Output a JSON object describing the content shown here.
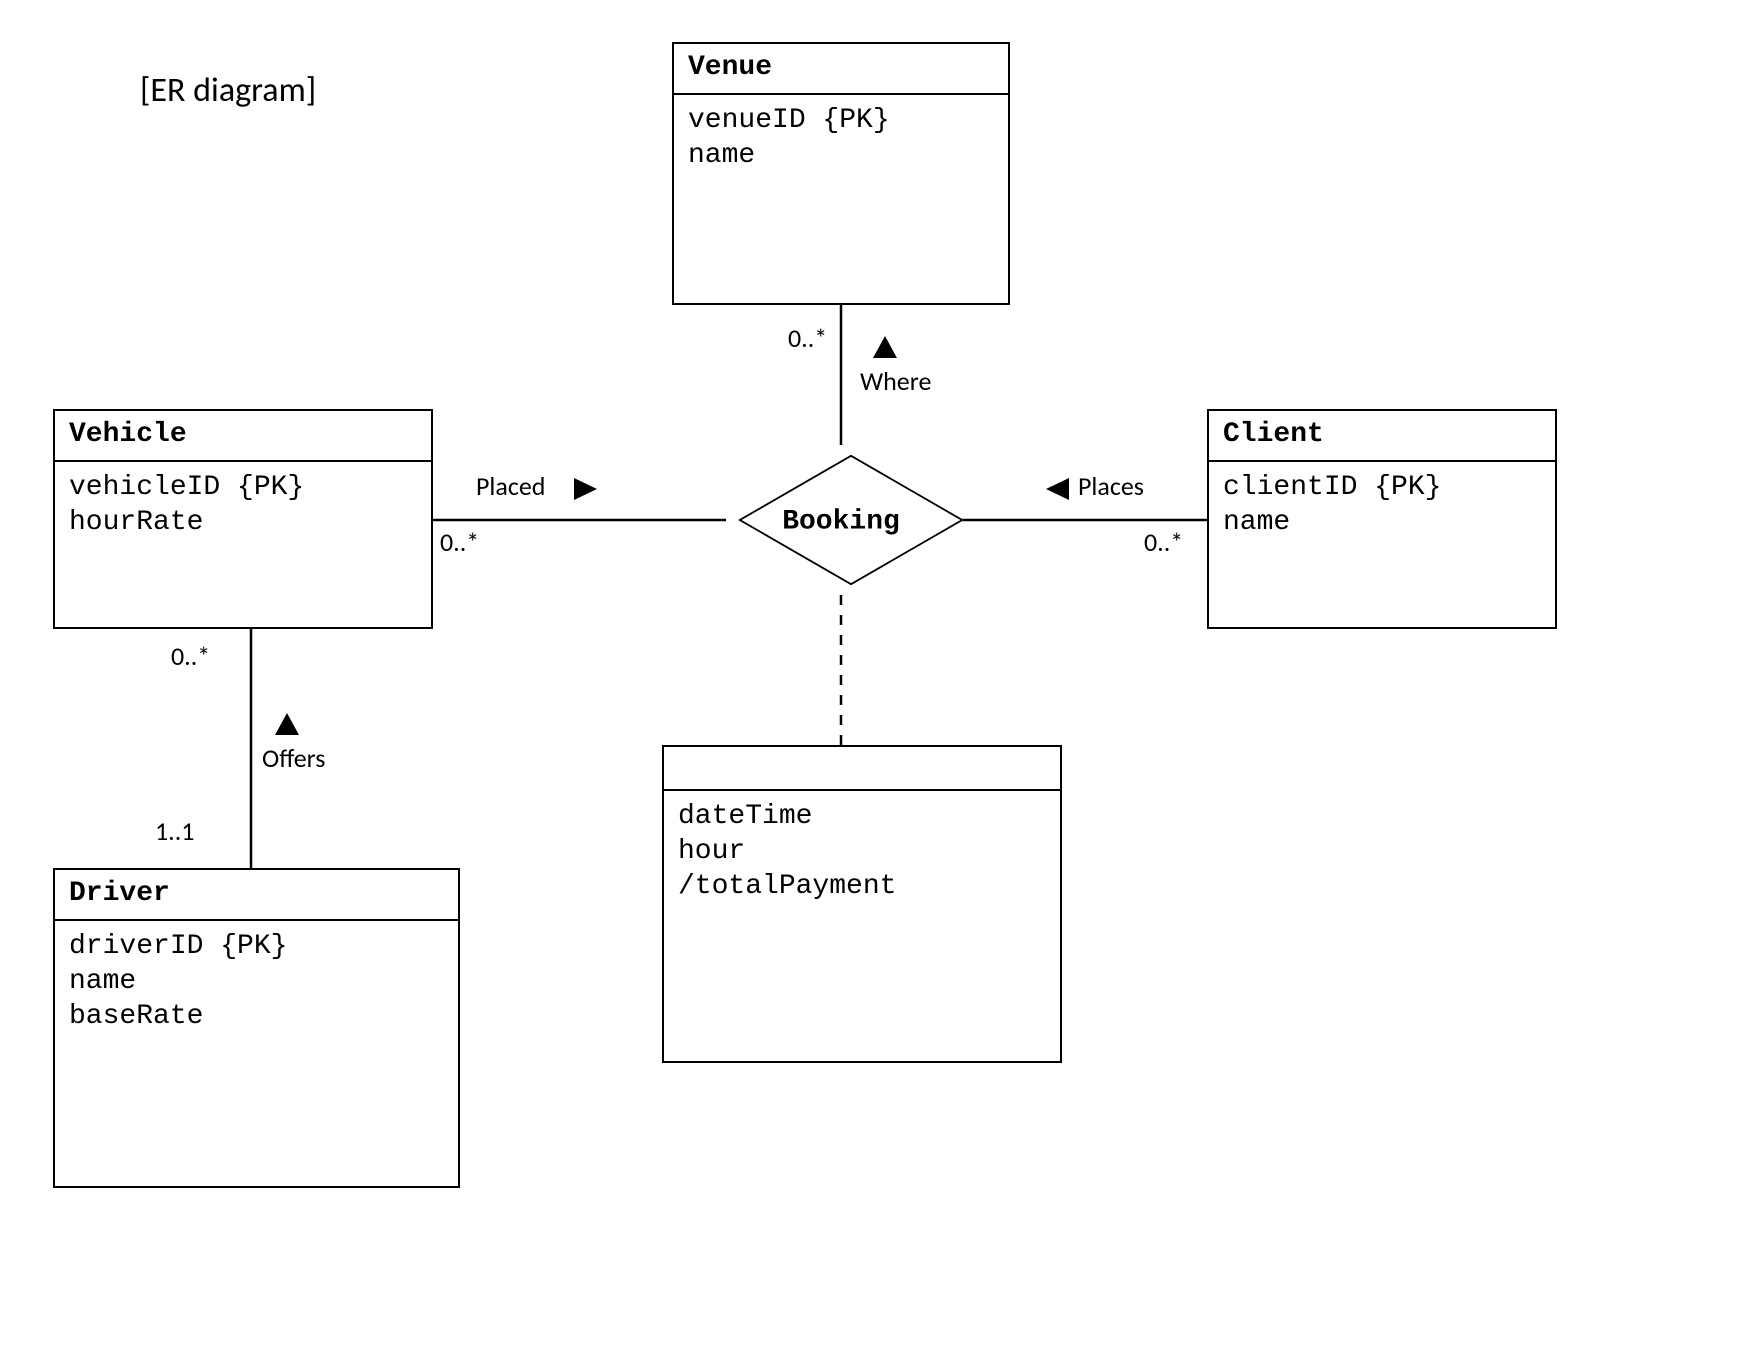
{
  "title": "[ER diagram]",
  "entities": {
    "venue": {
      "name": "Venue",
      "attrs": [
        "venueID {PK}",
        "name"
      ]
    },
    "vehicle": {
      "name": "Vehicle",
      "attrs": [
        "vehicleID {PK}",
        "hourRate"
      ]
    },
    "client": {
      "name": "Client",
      "attrs": [
        "clientID {PK}",
        "name"
      ]
    },
    "driver": {
      "name": "Driver",
      "attrs": [
        "driverID {PK}",
        "name",
        "baseRate"
      ]
    },
    "bookingAssoc": {
      "name": "",
      "attrs": [
        "dateTime",
        "hour",
        "/totalPayment"
      ]
    }
  },
  "relationship": {
    "booking": "Booking"
  },
  "edges": {
    "venue_booking": {
      "label": "Where",
      "mult": "0..*"
    },
    "vehicle_booking": {
      "label": "Placed",
      "mult": "0..*"
    },
    "client_booking": {
      "label": "Places",
      "mult": "0..*"
    },
    "vehicle_driver": {
      "label": "Offers",
      "multTop": "0..*",
      "multBottom": "1..1"
    }
  }
}
